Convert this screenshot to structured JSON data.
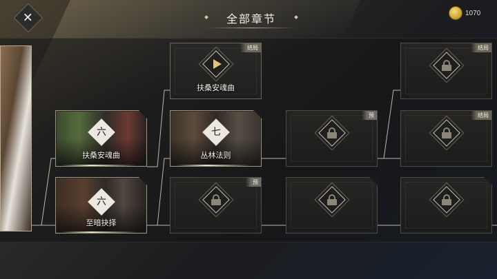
{
  "header": {
    "title": "全部章节",
    "coins": "1070",
    "close_icon": "close-icon",
    "coin_icon": "gold-coin-icon"
  },
  "chapters": [
    {
      "id": "c1",
      "numeral": "六",
      "label": "扶桑安魂曲",
      "state": "unlocked"
    },
    {
      "id": "c2",
      "numeral": "六",
      "label": "至暗抉择",
      "state": "unlocked"
    },
    {
      "id": "c3",
      "label": "扶桑安魂曲",
      "tag": "结局",
      "state": "current",
      "icon": "play-icon"
    },
    {
      "id": "c4",
      "numeral": "七",
      "label": "丛林法则",
      "state": "unlocked"
    },
    {
      "id": "c5",
      "tag": "预",
      "state": "locked",
      "icon": "lock-icon"
    },
    {
      "id": "c6",
      "tag": "预",
      "state": "locked",
      "icon": "lock-icon"
    },
    {
      "id": "c7",
      "state": "locked",
      "icon": "lock-icon"
    },
    {
      "id": "c8",
      "tag": "结局",
      "state": "locked",
      "icon": "lock-icon"
    },
    {
      "id": "c9",
      "tag": "结局",
      "state": "locked",
      "icon": "lock-icon"
    },
    {
      "id": "c10",
      "state": "locked",
      "icon": "lock-icon"
    }
  ],
  "colors": {
    "accent_gold": "#e4c57c",
    "line": "#d8d2c4",
    "card_border": "#6b6558"
  }
}
